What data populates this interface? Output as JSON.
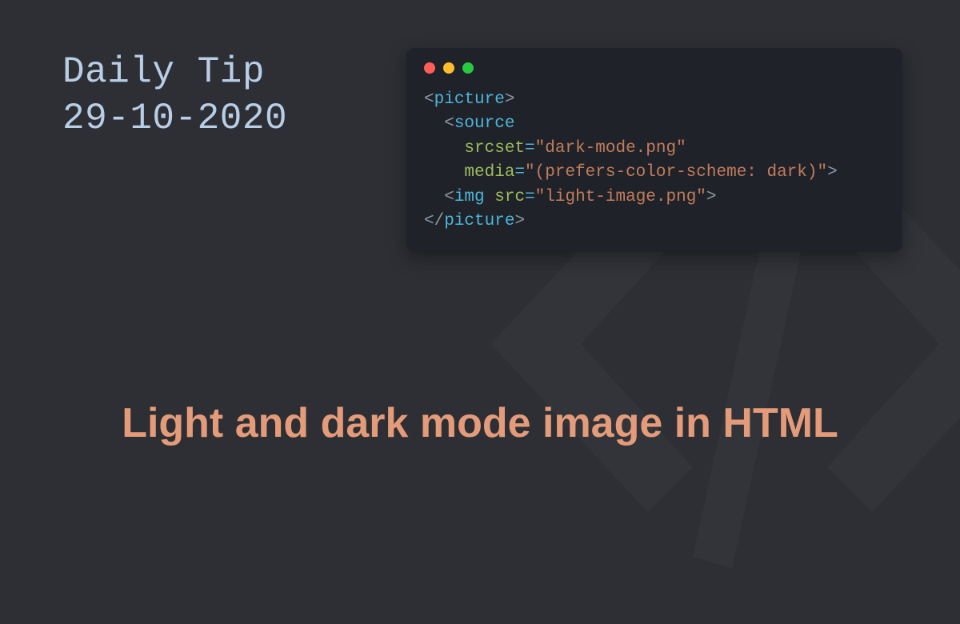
{
  "header": {
    "label": "Daily Tip",
    "date": "29-10-2020"
  },
  "code": {
    "tag_picture_open": "picture",
    "tag_source": "source",
    "attr_srcset": "srcset",
    "val_srcset": "\"dark-mode.png\"",
    "attr_media": "media",
    "val_media": "\"(prefers-color-scheme: dark)\"",
    "tag_img": "img",
    "attr_src": "src",
    "val_src": "\"light-image.png\"",
    "tag_picture_close": "picture"
  },
  "title": "Light and dark mode image in HTML",
  "glyph": {
    "name": "code-slash-watermark"
  },
  "colors": {
    "bg": "#2d2f34",
    "code_bg": "#1f2229",
    "header_text": "#b8cee6",
    "title_text": "#e39b79",
    "tag": "#4fb4d8",
    "attr": "#9fbc5c",
    "string": "#c27c5b",
    "punct": "#8d96a5"
  }
}
